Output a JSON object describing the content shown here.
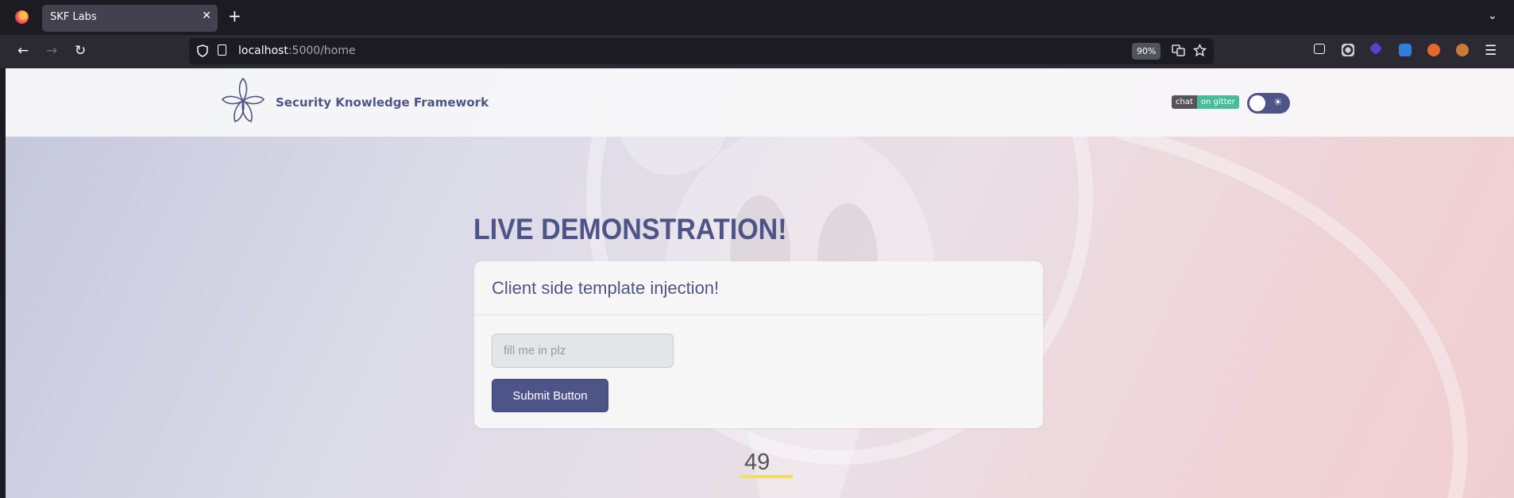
{
  "browser": {
    "tab_title": "SKF Labs",
    "tab_close": "✕",
    "new_tab": "+",
    "tab_list": "⌄",
    "url_host": "localhost",
    "url_path": ":5000/home",
    "zoom": "90%",
    "nav": {
      "back": "←",
      "forward": "→",
      "reload": "↻",
      "menu": "☰"
    }
  },
  "header": {
    "site_title": "Security Knowledge Framework",
    "gitter_left": "chat",
    "gitter_right": "on gitter",
    "theme_icon": "☀"
  },
  "main": {
    "heading": "LIVE DEMONSTRATION!",
    "card_title": "Client side template injection!",
    "input_placeholder": "fill me in plz",
    "input_value": "",
    "submit_label": "Submit Button",
    "result": "49"
  },
  "colors": {
    "accent": "#4f5488",
    "highlight": "#f5e53a",
    "gitter_green": "#46bc99"
  }
}
